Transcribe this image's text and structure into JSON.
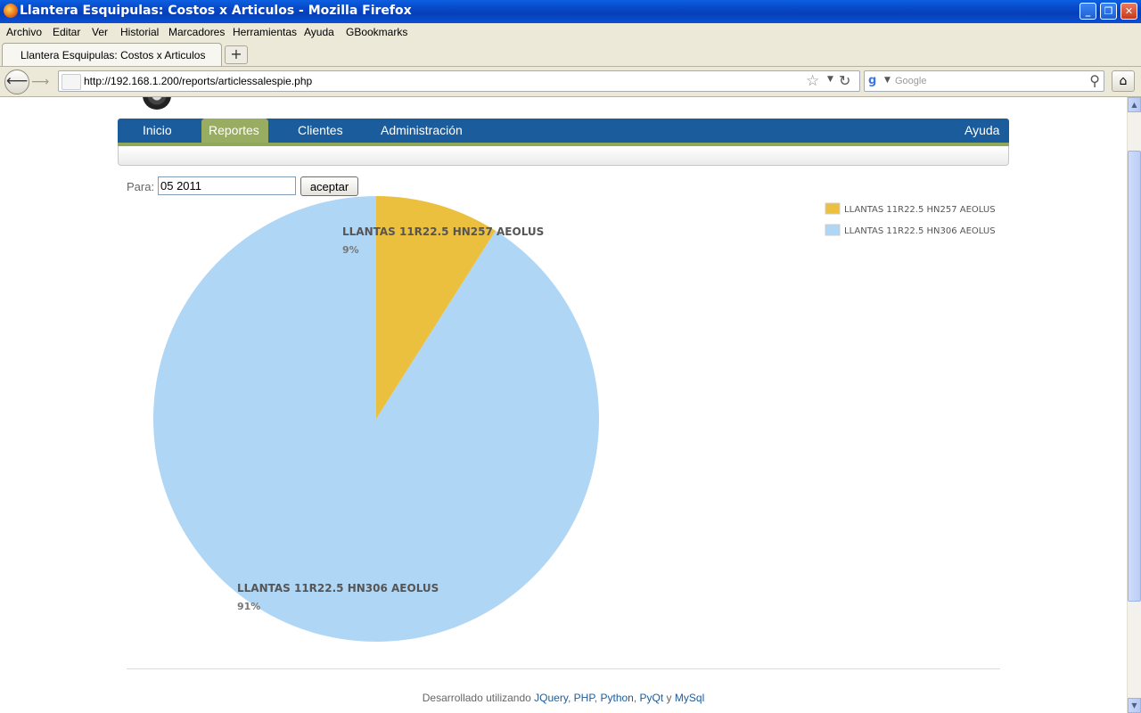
{
  "window": {
    "title": "Llantera Esquipulas: Costos x Articulos - Mozilla Firefox"
  },
  "menu": [
    "Archivo",
    "Editar",
    "Ver",
    "Historial",
    "Marcadores",
    "Herramientas",
    "Ayuda",
    "GBookmarks"
  ],
  "tab": {
    "title": "Llantera Esquipulas: Costos x Articulos",
    "new_tab": "+"
  },
  "nav": {
    "url": "http://192.168.1.200/reports/articlessalespie.php",
    "search_placeholder": "Google"
  },
  "site_nav": {
    "items": [
      "Inicio",
      "Reportes",
      "Clientes",
      "Administración"
    ],
    "active": "Reportes",
    "help": "Ayuda"
  },
  "form": {
    "label": "Para:",
    "value": "05 2011",
    "button": "aceptar"
  },
  "chart_data": {
    "type": "pie",
    "series": [
      {
        "name": "LLANTAS 11R22.5 HN257 AEOLUS",
        "value": 9,
        "label": "9%",
        "color": "#ecc03f"
      },
      {
        "name": "LLANTAS 11R22.5 HN306 AEOLUS",
        "value": 91,
        "label": "91%",
        "color": "#b0d6f5"
      }
    ],
    "legend_placement": "top-right"
  },
  "footer": {
    "prefix": "Desarrollado utilizando",
    "links": [
      "JQuery",
      "PHP",
      "Python",
      "PyQt",
      "MySql"
    ],
    "seps": [
      ",",
      ",",
      ",",
      "y"
    ]
  }
}
